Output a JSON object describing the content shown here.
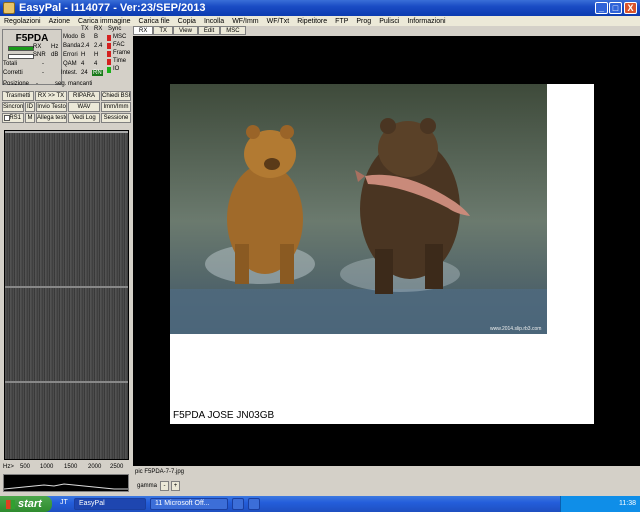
{
  "window": {
    "title": "EasyPal - I114077 - Ver:23/SEP/2013",
    "min_label": "_",
    "max_label": "□",
    "close_label": "X"
  },
  "menu": [
    "Regolazioni",
    "Azione",
    "Carica immagine",
    "Carica file",
    "Copia",
    "Incolla",
    "WF/Imm",
    "WF/Txt",
    "Ripetitore",
    "FTP",
    "Prog",
    "Pulisci",
    "Informazioni"
  ],
  "status": {
    "callsign": "F5PDA",
    "rx_label": "RX",
    "rx_unit": "Hz",
    "snr_label": "SNR",
    "snr_unit": "dB",
    "totali_label": "Totali",
    "totali_value": "-",
    "corretti_label": "Corretti",
    "corretti_value": "-",
    "posizione_label": "Posizione",
    "posizione_value": "-",
    "mancanti_label": "seg. mancanti",
    "rows": [
      "Modo",
      "Banda",
      "Errori",
      "QAM",
      "Intest."
    ],
    "tx_header": "TX",
    "rx_header": "RX",
    "tx_values": [
      "B",
      "2.4",
      "H",
      "4",
      "24"
    ],
    "rx_values": [
      "B",
      "2.4",
      "H",
      "4",
      "RN"
    ],
    "sync_header": "Sync",
    "sync_items": [
      "MSC",
      "FAC",
      "Frame",
      "Time",
      "IO"
    ]
  },
  "buttons": {
    "trasmetti": "Trasmetti",
    "rx_tx": "RX >> TX",
    "ripara": "RIPARA",
    "chiedi_bsr": "Chiedi BSR",
    "sincronizza": "Sincronizza",
    "id": "ID",
    "invio_testo": "Invio Testo",
    "wav": "WAV",
    "imm": "Imm/Imm",
    "rs1": "RS1",
    "m": "M",
    "allega_testo": "Allega testo",
    "vedi_log": "Vedi Log",
    "sessione": "Sessione"
  },
  "waterfall": {
    "axis_unit": "Hz>",
    "ticks": [
      "500",
      "1000",
      "1500",
      "2000",
      "2500"
    ]
  },
  "tabs": [
    "RX",
    "TX",
    "View",
    "Edit",
    "MSC"
  ],
  "image": {
    "caption": "F5PDA JOSE JN03GB",
    "watermark": "www.2014.slip.rb3.com"
  },
  "file": {
    "name": "pic F5PDA-7-7.jpg"
  },
  "gamma": {
    "label": "gamma",
    "minus": "-",
    "plus": "+"
  },
  "taskbar": {
    "start_label": "start",
    "quick": "JT",
    "tasks": [
      "EasyPal",
      "11 Microsoft Off...",
      "",
      ""
    ],
    "time": "11:38"
  },
  "colors": {
    "title_blue": "#0b3bb0",
    "start_green": "#2e8b2e",
    "sync_red": "#d42020",
    "sync_green": "#1bb01b"
  }
}
